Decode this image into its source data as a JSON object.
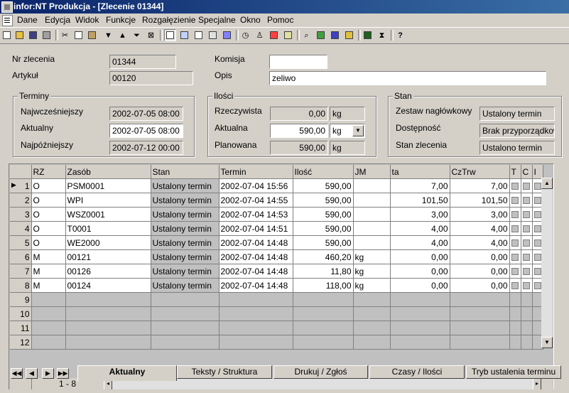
{
  "window": {
    "title": "infor:NT Produkcja - [Zlecenie 01344]"
  },
  "menu": [
    "Dane",
    "Edycja",
    "Widok",
    "Funkcje",
    "Rozgałęzienie",
    "Specjalne",
    "Okno",
    "Pomoc"
  ],
  "form": {
    "nr_zlecenia_label": "Nr zlecenia",
    "nr_zlecenia": "01344",
    "artykul_label": "Artykuł",
    "artykul": "00120",
    "komisja_label": "Komisja",
    "komisja": "",
    "opis_label": "Opis",
    "opis": "zeliwo"
  },
  "terminy": {
    "caption": "Terminy",
    "najwczesniejszy_label": "Najwcześniejszy",
    "najwczesniejszy": "2002-07-05 08:00",
    "aktualny_label": "Aktualny",
    "aktualny": "2002-07-05 08:00",
    "najpozniejszy_label": "Najpóźniejszy",
    "najpozniejszy": "2002-07-12 00:00"
  },
  "ilosci": {
    "caption": "Ilości",
    "rzeczywista_label": "Rzeczywista",
    "rzeczywista": "0,00",
    "rzeczywista_unit": "kg",
    "aktualna_label": "Aktualna",
    "aktualna": "590,00",
    "aktualna_unit": "kg",
    "planowana_label": "Planowana",
    "planowana": "590,00",
    "planowana_unit": "kg"
  },
  "stan": {
    "caption": "Stan",
    "zestaw_label": "Zestaw nagłówkowy",
    "zestaw": "Ustalony termin",
    "dostepnosc_label": "Dostępność",
    "dostepnosc": "Brak przyporządkowania",
    "stan_zlecenia_label": "Stan zlecenia",
    "stan_zlecenia": "Ustalono termin"
  },
  "grid": {
    "columns": [
      "RZ",
      "Zasób",
      "Stan",
      "Termin",
      "Ilość",
      "JM",
      "ta",
      "CzTrw",
      "T",
      "C",
      "I"
    ],
    "rows": [
      {
        "n": "1",
        "rz": "O",
        "zasob": "PSM0001",
        "stan": "Ustalony termin",
        "termin": "2002-07-04 15:56",
        "ilosc": "590,00",
        "jm": "",
        "ta": "7,00",
        "cztrw": "7,00"
      },
      {
        "n": "2",
        "rz": "O",
        "zasob": "WPI",
        "stan": "Ustalony termin",
        "termin": "2002-07-04 14:55",
        "ilosc": "590,00",
        "jm": "",
        "ta": "101,50",
        "cztrw": "101,50"
      },
      {
        "n": "3",
        "rz": "O",
        "zasob": "WSZ0001",
        "stan": "Ustalony termin",
        "termin": "2002-07-04 14:53",
        "ilosc": "590,00",
        "jm": "",
        "ta": "3,00",
        "cztrw": "3,00"
      },
      {
        "n": "4",
        "rz": "O",
        "zasob": "T0001",
        "stan": "Ustalony termin",
        "termin": "2002-07-04 14:51",
        "ilosc": "590,00",
        "jm": "",
        "ta": "4,00",
        "cztrw": "4,00"
      },
      {
        "n": "5",
        "rz": "O",
        "zasob": "WE2000",
        "stan": "Ustalony termin",
        "termin": "2002-07-04 14:48",
        "ilosc": "590,00",
        "jm": "",
        "ta": "4,00",
        "cztrw": "4,00"
      },
      {
        "n": "6",
        "rz": "M",
        "zasob": "00121",
        "stan": "Ustalony termin",
        "termin": "2002-07-04 14:48",
        "ilosc": "460,20",
        "jm": "kg",
        "ta": "0,00",
        "cztrw": "0,00"
      },
      {
        "n": "7",
        "rz": "M",
        "zasob": "00126",
        "stan": "Ustalony termin",
        "termin": "2002-07-04 14:48",
        "ilosc": "11,80",
        "jm": "kg",
        "ta": "0,00",
        "cztrw": "0,00"
      },
      {
        "n": "8",
        "rz": "M",
        "zasob": "00124",
        "stan": "Ustalony termin",
        "termin": "2002-07-04 14:48",
        "ilosc": "118,00",
        "jm": "kg",
        "ta": "0,00",
        "cztrw": "0,00"
      }
    ],
    "empty_rows": [
      "9",
      "10",
      "11",
      "12"
    ],
    "footer_range": "1 - 8"
  },
  "tabs": [
    "Aktualny",
    "Teksty / Struktura",
    "Drukuj / Zgłoś",
    "Czasy / Ilości",
    "Tryb ustalenia terminu"
  ],
  "toolbar_help": "?"
}
